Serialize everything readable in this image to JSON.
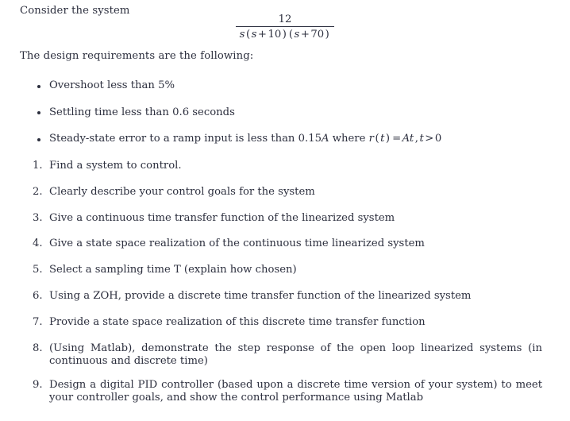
{
  "document": {
    "intro_paragraph": "Consider the system",
    "requirements_paragraph": "The design requirements are the following:",
    "transfer_function": {
      "numerator": "12",
      "denominator_parts": {
        "s1": "s",
        "open1": "(",
        "s2": "s",
        "plus1": "+",
        "ten": "10",
        "close1": ")",
        "open2": "(",
        "s3": "s",
        "plus2": "+",
        "seventy": "70",
        "close2": ")"
      },
      "plain_text": "12 / (s(s + 10)(s + 70))"
    },
    "requirements": [
      "Overshoot less than 5%",
      "Settling time less than 0.6 seconds",
      "Steady-state error to a ramp input is less than 0.15A where r(t) = At, t > 0"
    ],
    "requirement_3_segments": {
      "lead": "Steady-state error to a ramp input is less than 0.15",
      "var_A": "A",
      "where": "where",
      "r": "r",
      "open": "(",
      "t1": "t",
      "close": ")",
      "equals": "=",
      "A2": "A",
      "t2": "t",
      "comma": ",",
      "t3": "t",
      "gt": ">",
      "zero": "0"
    },
    "tasks": [
      {
        "number": "1.",
        "text": "Find a system to control."
      },
      {
        "number": "2.",
        "text": "Clearly describe your control goals for the system"
      },
      {
        "number": "3.",
        "text": "Give a continuous time transfer function of the linearized system"
      },
      {
        "number": "4.",
        "text": "Give a state space realization of the continuous time linearized system"
      },
      {
        "number": "5.",
        "text": "Select a sampling time T (explain how chosen)"
      },
      {
        "number": "6.",
        "text": "Using a ZOH, provide a discrete time transfer function of the linearized system"
      },
      {
        "number": "7.",
        "text": "Provide a state space realization of this discrete time transfer function"
      },
      {
        "number": "8.",
        "text": "(Using Matlab), demonstrate the step response of the open loop linearized systems (in continuous and discrete time)"
      },
      {
        "number": "9.",
        "text": "Design a digital PID controller (based upon a discrete time version of your system) to meet your controller goals, and show the control performance using Matlab"
      }
    ],
    "colors": {
      "text": "#2c2f3e",
      "background": "#ffffff"
    }
  }
}
